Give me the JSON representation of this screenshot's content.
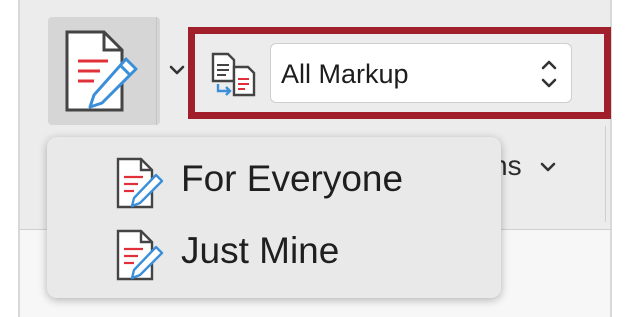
{
  "toolbar": {
    "track_changes_icon": "track-changes-pencil-icon",
    "track_changes_dropdown_icon": "chevron-down-icon",
    "markup_icon": "display-for-review-icon",
    "markup_select": {
      "value": "All Markup",
      "stepper_icon": "up-down-chevron-icon"
    },
    "hidden_button": {
      "label": "ns",
      "icon": "chevron-down-icon"
    }
  },
  "dropdown_menu": {
    "items": [
      {
        "label": "For Everyone",
        "icon": "track-changes-pencil-icon"
      },
      {
        "label": "Just Mine",
        "icon": "track-changes-pencil-icon"
      }
    ]
  },
  "colors": {
    "highlight_border": "#a01f2a",
    "accent_blue": "#3b8fd9",
    "accent_red": "#e0303a",
    "menu_bg": "#e9e9e9",
    "ribbon_bg": "#ececec"
  }
}
